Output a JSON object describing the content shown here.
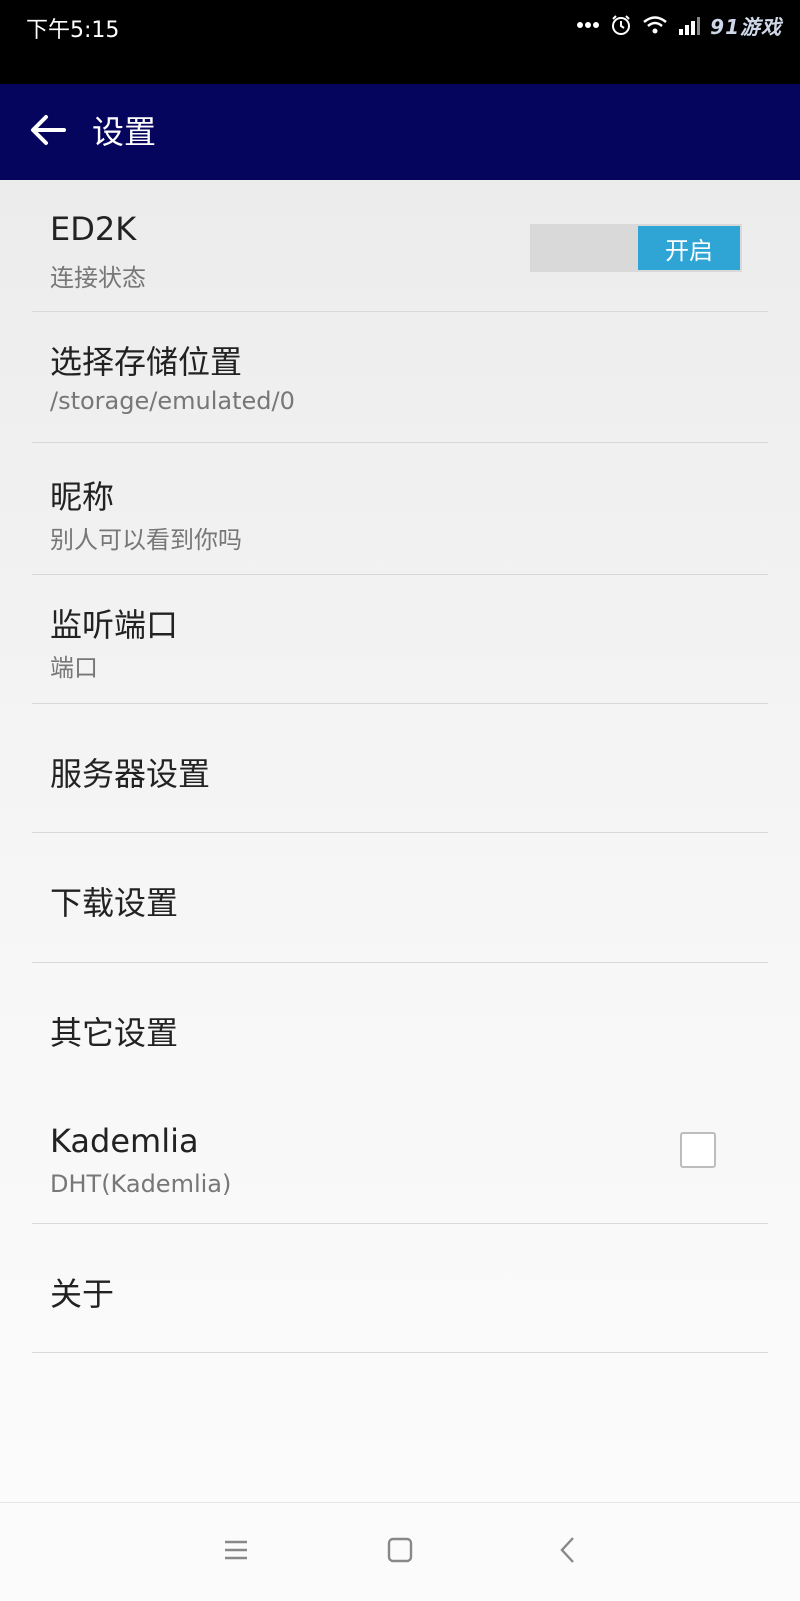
{
  "status_bar": {
    "time": "下午5:15",
    "watermark": "91游戏",
    "icons": [
      "more-icon",
      "alarm-icon",
      "wifi-icon",
      "signal-icon",
      "battery-icon"
    ]
  },
  "app_bar": {
    "title": "设置",
    "background": "#05055e"
  },
  "settings": [
    {
      "title": "ED2K",
      "subtitle": "连接状态",
      "control": "toggle",
      "toggle_label": "开启",
      "toggle_on": true
    },
    {
      "title": "选择存储位置",
      "subtitle": "/storage/emulated/0"
    },
    {
      "title": "昵称",
      "subtitle": "别人可以看到你吗"
    },
    {
      "title": "监听端口",
      "subtitle": "端口"
    },
    {
      "title": "服务器设置"
    },
    {
      "title": "下载设置"
    },
    {
      "title": "其它设置"
    },
    {
      "title": "Kademlia",
      "subtitle": "DHT(Kademlia)",
      "control": "checkbox",
      "checked": false
    },
    {
      "title": "关于"
    }
  ],
  "colors": {
    "toggle_on": "#2fa5d6",
    "divider": "#d8d8d8"
  },
  "nav_bar": {
    "icons": [
      "menu-icon",
      "home-icon",
      "back-icon"
    ]
  }
}
